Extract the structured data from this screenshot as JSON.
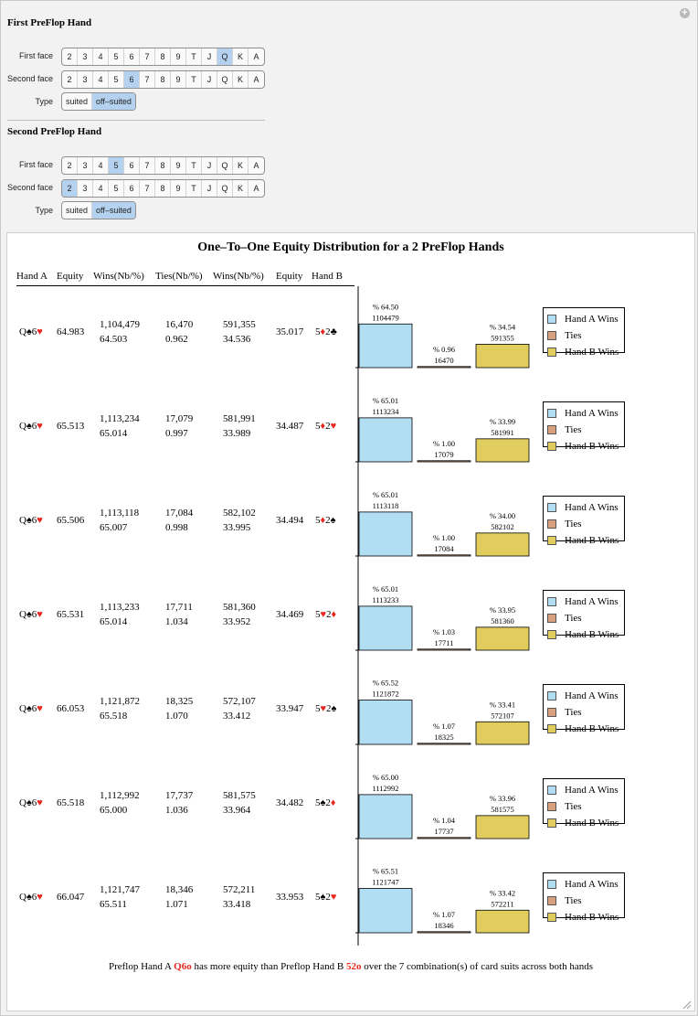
{
  "controls": {
    "first_title": "First PreFlop Hand",
    "second_title": "Second PreFlop Hand",
    "first_face_label": "First face",
    "second_face_label": "Second face",
    "type_label": "Type",
    "ranks": [
      "2",
      "3",
      "4",
      "5",
      "6",
      "7",
      "8",
      "9",
      "T",
      "J",
      "Q",
      "K",
      "A"
    ],
    "types": [
      "suited",
      "off–suited"
    ],
    "hand1": {
      "first_face": "Q",
      "second_face": "6",
      "type": "off–suited"
    },
    "hand2": {
      "first_face": "5",
      "second_face": "2",
      "type": "off–suited"
    }
  },
  "panel": {
    "title": "One–To–One Equity Distribution for a 2 PreFlop Hands",
    "headers": [
      "Hand A",
      "Equity",
      "Wins(Nb/%)",
      "Ties(Nb/%)",
      "Wins(Nb/%)",
      "Equity",
      "Hand B"
    ],
    "legend": [
      "Hand A Wins",
      "Ties",
      "Hand B Wins"
    ],
    "colors": {
      "a": "#b2def3",
      "ties": "#d8a07f",
      "b": "#e1cd5d",
      "red": "#e8281e"
    },
    "rows": [
      {
        "hand_a": [
          {
            "t": "Q",
            "red": false
          },
          {
            "t": "♠",
            "red": false
          },
          {
            "t": "6",
            "red": false
          },
          {
            "t": "♥",
            "red": true
          }
        ],
        "equity_a": "64.983",
        "wins_a_nb": "1,104,479",
        "wins_a_pct": "64.503",
        "ties_nb": "16,470",
        "ties_pct": "0.962",
        "wins_b_nb": "591,355",
        "wins_b_pct": "34.536",
        "equity_b": "35.017",
        "hand_b": [
          {
            "t": "5",
            "red": false
          },
          {
            "t": "♦",
            "red": true
          },
          {
            "t": "2",
            "red": false
          },
          {
            "t": "♣",
            "red": false
          }
        ],
        "bars": {
          "a_pct": "% 64.50",
          "a_nb": "1104479",
          "a": 64.5,
          "t_pct": "% 0.96",
          "t_nb": "16470",
          "t": 0.96,
          "b_pct": "% 34.54",
          "b_nb": "591355",
          "b": 34.54
        }
      },
      {
        "hand_a": [
          {
            "t": "Q",
            "red": false
          },
          {
            "t": "♠",
            "red": false
          },
          {
            "t": "6",
            "red": false
          },
          {
            "t": "♥",
            "red": true
          }
        ],
        "equity_a": "65.513",
        "wins_a_nb": "1,113,234",
        "wins_a_pct": "65.014",
        "ties_nb": "17,079",
        "ties_pct": "0.997",
        "wins_b_nb": "581,991",
        "wins_b_pct": "33.989",
        "equity_b": "34.487",
        "hand_b": [
          {
            "t": "5",
            "red": false
          },
          {
            "t": "♦",
            "red": true
          },
          {
            "t": "2",
            "red": false
          },
          {
            "t": "♥",
            "red": true
          }
        ],
        "bars": {
          "a_pct": "% 65.01",
          "a_nb": "1113234",
          "a": 65.01,
          "t_pct": "% 1.00",
          "t_nb": "17079",
          "t": 1.0,
          "b_pct": "% 33.99",
          "b_nb": "581991",
          "b": 33.99
        }
      },
      {
        "hand_a": [
          {
            "t": "Q",
            "red": false
          },
          {
            "t": "♠",
            "red": false
          },
          {
            "t": "6",
            "red": false
          },
          {
            "t": "♥",
            "red": true
          }
        ],
        "equity_a": "65.506",
        "wins_a_nb": "1,113,118",
        "wins_a_pct": "65.007",
        "ties_nb": "17,084",
        "ties_pct": "0.998",
        "wins_b_nb": "582,102",
        "wins_b_pct": "33.995",
        "equity_b": "34.494",
        "hand_b": [
          {
            "t": "5",
            "red": false
          },
          {
            "t": "♦",
            "red": true
          },
          {
            "t": "2",
            "red": false
          },
          {
            "t": "♠",
            "red": false
          }
        ],
        "bars": {
          "a_pct": "% 65.01",
          "a_nb": "1113118",
          "a": 65.01,
          "t_pct": "% 1.00",
          "t_nb": "17084",
          "t": 1.0,
          "b_pct": "% 34.00",
          "b_nb": "582102",
          "b": 34.0
        }
      },
      {
        "hand_a": [
          {
            "t": "Q",
            "red": false
          },
          {
            "t": "♠",
            "red": false
          },
          {
            "t": "6",
            "red": false
          },
          {
            "t": "♥",
            "red": true
          }
        ],
        "equity_a": "65.531",
        "wins_a_nb": "1,113,233",
        "wins_a_pct": "65.014",
        "ties_nb": "17,711",
        "ties_pct": "1.034",
        "wins_b_nb": "581,360",
        "wins_b_pct": "33.952",
        "equity_b": "34.469",
        "hand_b": [
          {
            "t": "5",
            "red": false
          },
          {
            "t": "♥",
            "red": true
          },
          {
            "t": "2",
            "red": false
          },
          {
            "t": "♦",
            "red": true
          }
        ],
        "bars": {
          "a_pct": "% 65.01",
          "a_nb": "1113233",
          "a": 65.01,
          "t_pct": "% 1.03",
          "t_nb": "17711",
          "t": 1.03,
          "b_pct": "% 33.95",
          "b_nb": "581360",
          "b": 33.95
        }
      },
      {
        "hand_a": [
          {
            "t": "Q",
            "red": false
          },
          {
            "t": "♠",
            "red": false
          },
          {
            "t": "6",
            "red": false
          },
          {
            "t": "♥",
            "red": true
          }
        ],
        "equity_a": "66.053",
        "wins_a_nb": "1,121,872",
        "wins_a_pct": "65.518",
        "ties_nb": "18,325",
        "ties_pct": "1.070",
        "wins_b_nb": "572,107",
        "wins_b_pct": "33.412",
        "equity_b": "33.947",
        "hand_b": [
          {
            "t": "5",
            "red": false
          },
          {
            "t": "♥",
            "red": true
          },
          {
            "t": "2",
            "red": false
          },
          {
            "t": "♠",
            "red": false
          }
        ],
        "bars": {
          "a_pct": "% 65.52",
          "a_nb": "1121872",
          "a": 65.52,
          "t_pct": "% 1.07",
          "t_nb": "18325",
          "t": 1.07,
          "b_pct": "% 33.41",
          "b_nb": "572107",
          "b": 33.41
        }
      },
      {
        "hand_a": [
          {
            "t": "Q",
            "red": false
          },
          {
            "t": "♠",
            "red": false
          },
          {
            "t": "6",
            "red": false
          },
          {
            "t": "♥",
            "red": true
          }
        ],
        "equity_a": "65.518",
        "wins_a_nb": "1,112,992",
        "wins_a_pct": "65.000",
        "ties_nb": "17,737",
        "ties_pct": "1.036",
        "wins_b_nb": "581,575",
        "wins_b_pct": "33.964",
        "equity_b": "34.482",
        "hand_b": [
          {
            "t": "5",
            "red": false
          },
          {
            "t": "♠",
            "red": false
          },
          {
            "t": "2",
            "red": false
          },
          {
            "t": "♦",
            "red": true
          }
        ],
        "bars": {
          "a_pct": "% 65.00",
          "a_nb": "1112992",
          "a": 65.0,
          "t_pct": "% 1.04",
          "t_nb": "17737",
          "t": 1.04,
          "b_pct": "% 33.96",
          "b_nb": "581575",
          "b": 33.96
        }
      },
      {
        "hand_a": [
          {
            "t": "Q",
            "red": false
          },
          {
            "t": "♠",
            "red": false
          },
          {
            "t": "6",
            "red": false
          },
          {
            "t": "♥",
            "red": true
          }
        ],
        "equity_a": "66.047",
        "wins_a_nb": "1,121,747",
        "wins_a_pct": "65.511",
        "ties_nb": "18,346",
        "ties_pct": "1.071",
        "wins_b_nb": "572,211",
        "wins_b_pct": "33.418",
        "equity_b": "33.953",
        "hand_b": [
          {
            "t": "5",
            "red": false
          },
          {
            "t": "♠",
            "red": false
          },
          {
            "t": "2",
            "red": false
          },
          {
            "t": "♥",
            "red": true
          }
        ],
        "bars": {
          "a_pct": "% 65.51",
          "a_nb": "1121747",
          "a": 65.51,
          "t_pct": "% 1.07",
          "t_nb": "18346",
          "t": 1.07,
          "b_pct": "% 33.42",
          "b_nb": "572211",
          "b": 33.42
        }
      }
    ],
    "footer": {
      "pre": "Preflop Hand A ",
      "hand_a": "Q6o",
      "mid": " has more equity than Preflop Hand B ",
      "hand_b": "52o",
      "post": " over the 7 combination(s) of card suits across both hands"
    }
  }
}
